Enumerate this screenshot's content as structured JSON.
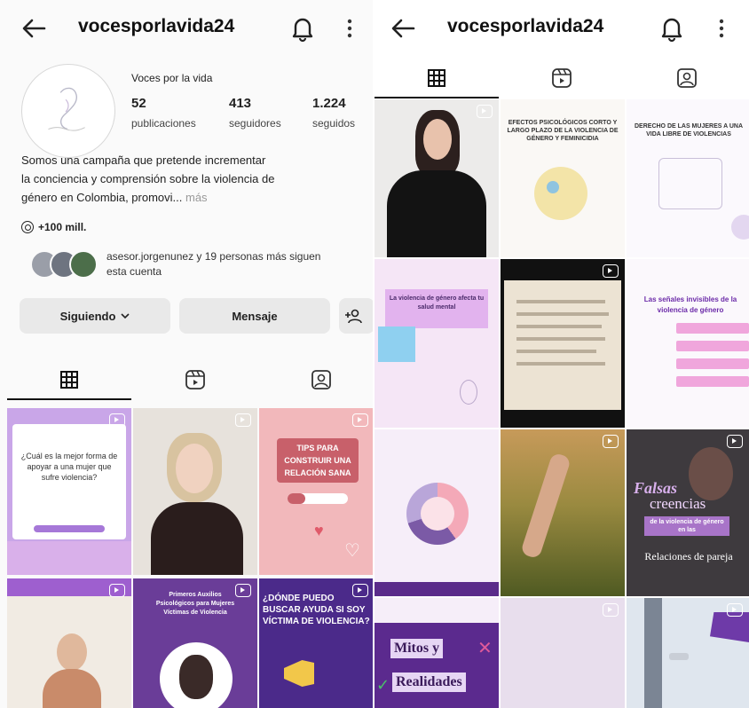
{
  "left": {
    "header": {
      "username": "vocesporlavida24"
    },
    "profile": {
      "name": "Voces por la vida",
      "stats": [
        {
          "num": "52",
          "label": "publicaciones"
        },
        {
          "num": "413",
          "label": "seguidores"
        },
        {
          "num": "1.224",
          "label": "seguidos"
        }
      ],
      "bio_line1": "Somos una campaña que pretende incrementar",
      "bio_line2": "la conciencia y comprensión sobre la violencia de",
      "bio_line3": "género en Colombia, promovi...",
      "bio_more": "más",
      "threads_count": "+100 mill.",
      "followed_by": "asesor.jorgenunez y 19 personas más siguen esta cuenta"
    },
    "buttons": {
      "following": "Siguiendo",
      "message": "Mensaje"
    },
    "tiles": {
      "t1_text": "¿Cuál es la mejor forma de apoyar a una mujer que sufre violencia?",
      "t3_text": "TIPS PARA CONSTRUIR UNA RELACIÓN SANA",
      "t5_text": "Primeros Auxilios Psicológicos para Mujeres Víctimas de Violencia",
      "t6_text": "¿DÓNDE PUEDO BUSCAR AYUDA SI SOY VÍCTIMA DE VIOLENCIA?"
    }
  },
  "right": {
    "header": {
      "username": "vocesporlavida24"
    },
    "tiles": {
      "r2_text": "EFECTOS PSICOLÓGICOS CORTO Y LARGO PLAZO DE LA VIOLENCIA DE GÉNERO Y FEMINICIDIA",
      "r3_text": "DERECHO DE LAS MUJERES A UNA VIDA LIBRE DE VIOLENCIAS",
      "r4_text": "La violencia de género afecta tu salud mental",
      "r6_text": "Las señales invisibles de la violencia de género",
      "r9a_text": "Falsas",
      "r9b_text": "creencias",
      "r9c_text": "de la violencia de género en las",
      "r9d_text": "Relaciones de pareja",
      "r10a_text": "Mitos y",
      "r10b_text": "Realidades"
    }
  },
  "colors": {
    "lavender": "#e6dbf2",
    "purple": "#6b3f9b",
    "pink": "#f2b6b8",
    "text": "#111111"
  }
}
